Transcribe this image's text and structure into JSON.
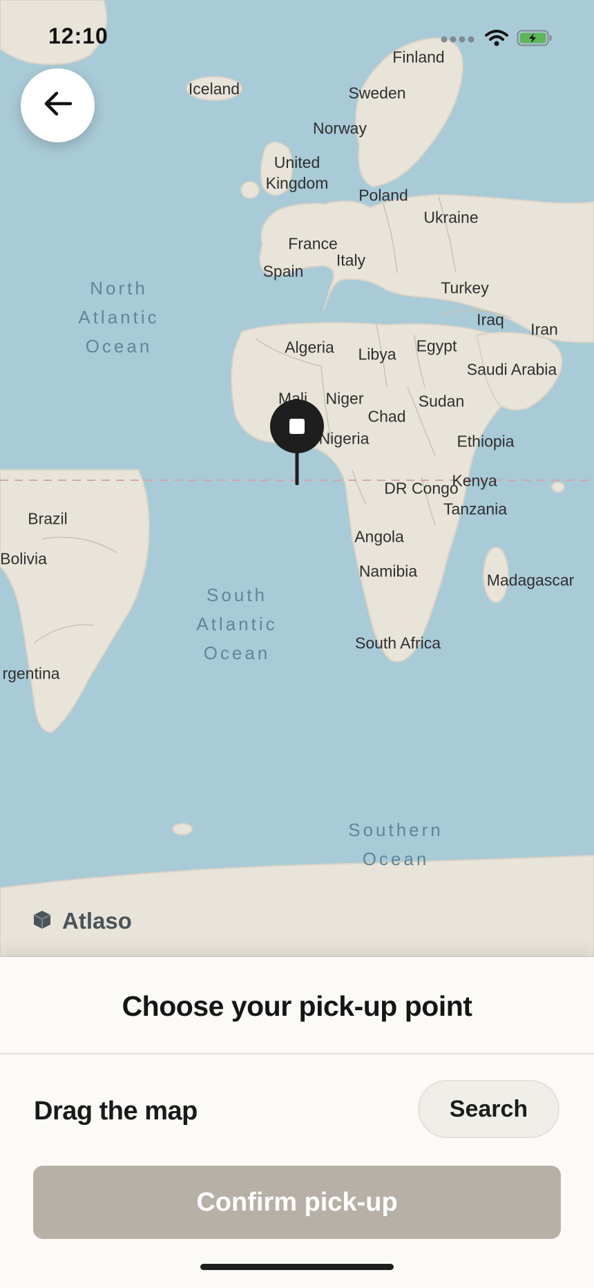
{
  "status_bar": {
    "time": "12:10",
    "icons": [
      "signal-dots-icon",
      "wifi-icon",
      "battery-charging-icon"
    ],
    "battery_color": "#5fb55a"
  },
  "map": {
    "back_icon": "arrow-left-icon",
    "countries": [
      "Finland",
      "Iceland",
      "Sweden",
      "Norway",
      "United Kingdom",
      "Poland",
      "Ukraine",
      "France",
      "Italy",
      "Spain",
      "Turkey",
      "Iraq",
      "Iran",
      "Algeria",
      "Libya",
      "Egypt",
      "Saudi Arabia",
      "Mali",
      "Niger",
      "Sudan",
      "Chad",
      "Nigeria",
      "Ethiopia",
      "Kenya",
      "DR Congo",
      "Tanzania",
      "Brazil",
      "Bolivia",
      "Angola",
      "Namibia",
      "Madagascar",
      "South Africa",
      "rgentina"
    ],
    "oceans": {
      "north_atlantic": [
        "North",
        "Atlantic",
        "Ocean"
      ],
      "south_atlantic": [
        "South",
        "Atlantic",
        "Ocean"
      ],
      "southern": [
        "Southern",
        "Ocean"
      ]
    },
    "brand": "Atlaso",
    "brand_icon": "cube-logo-icon",
    "pin_icon": "location-pin-icon",
    "colors": {
      "water": "#a9cad7",
      "land": "#e8e4da",
      "equator": "#d4a6a8"
    }
  },
  "sheet": {
    "title": "Choose your pick-up point",
    "instruction": "Drag the map",
    "search_label": "Search",
    "confirm_label": "Confirm pick-up",
    "confirm_color": "#b6b0a7"
  }
}
